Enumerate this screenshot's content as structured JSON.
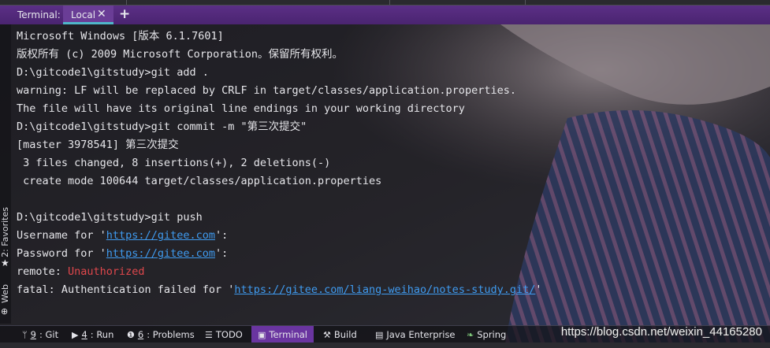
{
  "tab_bar": {
    "title": "Terminal:",
    "active_tab": "Local",
    "close_glyph": "✕",
    "add_glyph": "+"
  },
  "sidebar": {
    "favorites_label": "2: Favorites",
    "web_label": "Web"
  },
  "terminal": {
    "lines": [
      "Microsoft Windows [版本 6.1.7601]",
      "版权所有 (c) 2009 Microsoft Corporation。保留所有权利。",
      "D:\\gitcode1\\gitstudy>git add .",
      "warning: LF will be replaced by CRLF in target/classes/application.properties.",
      "The file will have its original line endings in your working directory",
      "D:\\gitcode1\\gitstudy>git commit -m \"第三次提交\"",
      "[master 3978541] 第三次提交",
      " 3 files changed, 8 insertions(+), 2 deletions(-)",
      " create mode 100644 target/classes/application.properties",
      "",
      "D:\\gitcode1\\gitstudy>git push"
    ],
    "username_prefix": "Username for '",
    "username_url": "https://gitee.com",
    "username_suffix": "':",
    "password_prefix": "Password for '",
    "password_url": "https://gitee.com",
    "password_suffix": "':",
    "remote_prefix": "remote: ",
    "remote_error": "Unauthorized",
    "fatal_prefix": "fatal: Authentication failed for '",
    "fatal_url": "https://gitee.com/liang-weihao/notes-study.git/",
    "fatal_suffix": "'"
  },
  "bottom_tools": [
    {
      "num": "9",
      "label": ": Git",
      "icon": "git-branch-icon"
    },
    {
      "num": "4",
      "label": ": Run",
      "icon": "run-icon"
    },
    {
      "num": "6",
      "label": ": Problems",
      "icon": "problems-icon"
    },
    {
      "num": "",
      "label": "TODO",
      "icon": "todo-icon"
    },
    {
      "num": "",
      "label": "Terminal",
      "icon": "terminal-icon"
    },
    {
      "num": "",
      "label": "Build",
      "icon": "build-icon"
    },
    {
      "num": "",
      "label": "Java Enterprise",
      "icon": "java-enterprise-icon"
    },
    {
      "num": "",
      "label": "Spring",
      "icon": "spring-icon"
    }
  ],
  "watermark": "https://blog.csdn.net/weixin_44165280",
  "colors": {
    "tab_bar": "#5b2f86",
    "active_tool": "#6a35a0",
    "link": "#3f9bf0",
    "error": "#e0474c",
    "text": "#e6e6ea"
  }
}
